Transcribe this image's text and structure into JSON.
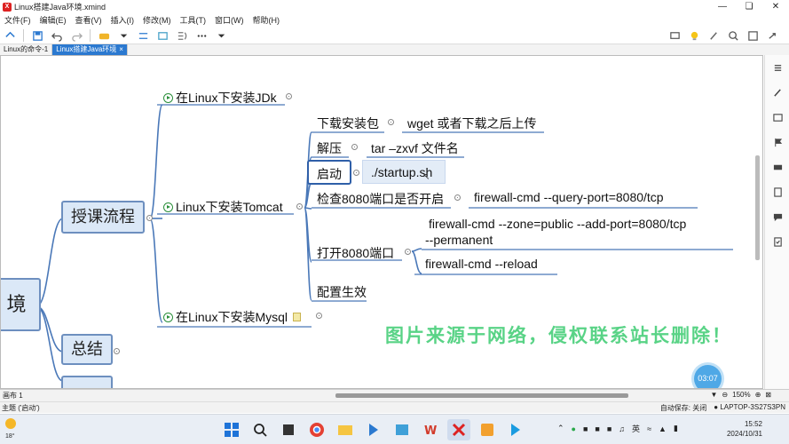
{
  "window": {
    "title": "Linux搭建Java环境.xmind",
    "app_icon_letter": "X"
  },
  "menu": [
    "文件(F)",
    "编辑(E)",
    "查看(V)",
    "插入(I)",
    "修改(M)",
    "工具(T)",
    "窗口(W)",
    "帮助(H)"
  ],
  "tabs": [
    {
      "label": "Linux的命令-1",
      "active": false
    },
    {
      "label": "Linux搭建Java环境",
      "active": true,
      "close": "×"
    }
  ],
  "mindmap": {
    "central_fragment": "境",
    "main_topics": {
      "course_flow": "授课流程",
      "summary": "总结"
    },
    "branches": {
      "jdk": "在Linux下安装JDk",
      "tomcat": "Linux下安装Tomcat",
      "mysql": "在Linux下安装Mysql"
    },
    "tomcat_steps": {
      "download": "下载安装包",
      "download_cmd": "wget 或者下载之后上传",
      "extract": "解压",
      "extract_cmd": "tar –zxvf 文件名",
      "start": "启动",
      "start_cmd": "./startup.sh",
      "check_port": "检查8080端口是否开启",
      "check_port_cmd": "firewall-cmd --query-port=8080/tcp",
      "open_port": "打开8080端口",
      "open_port_cmd1_line1": "firewall-cmd --zone=public --add-port=8080/tcp",
      "open_port_cmd1_line2": "--permanent",
      "open_port_cmd2": "firewall-cmd --reload",
      "apply_config": "配置生效"
    }
  },
  "watermark": "图片来源于网络，侵权联系站长删除！",
  "timer": "03:07",
  "status": {
    "sheet": "画布 1",
    "zoom": "150%",
    "topic": "主题 ('启动')",
    "autosave": "自动保存: 关闭",
    "machine": "LAPTOP-3S27S3PN"
  },
  "taskbar": {
    "weather_temp": "18°",
    "ime": "英",
    "time": "15:52",
    "date": "2024/10/31"
  },
  "colors": {
    "accent": "#2b79d0",
    "main_topic_fill": "#dbe8f7",
    "main_topic_border": "#6d8fbf",
    "watermark": "#22c55e"
  }
}
